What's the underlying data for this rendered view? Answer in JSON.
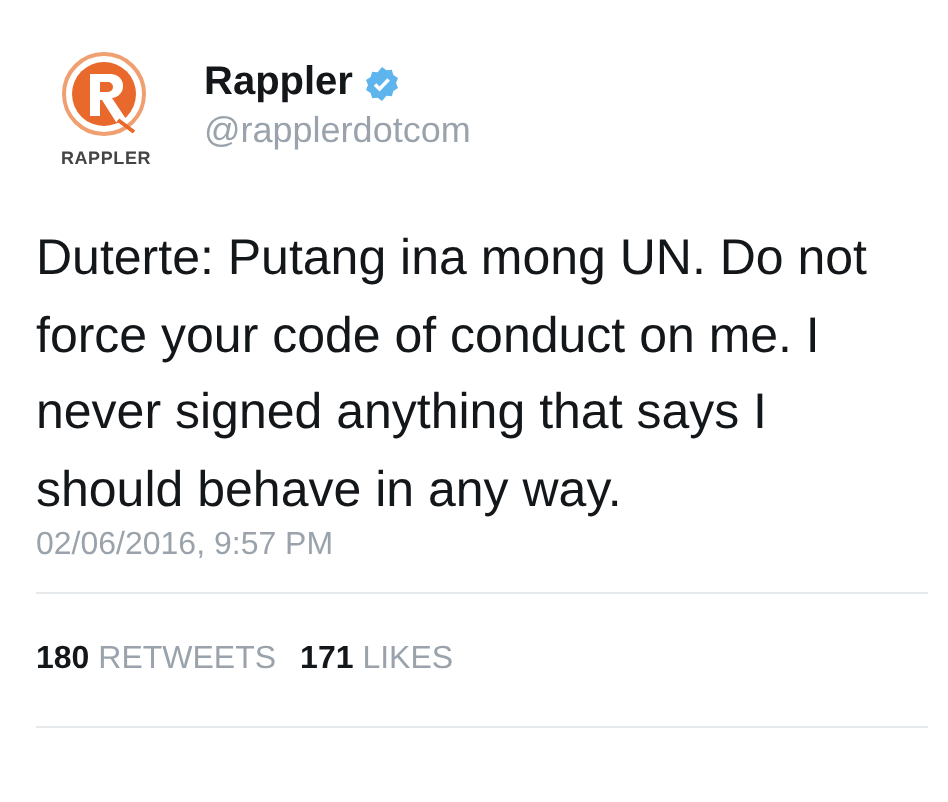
{
  "account": {
    "logo_wordmark": "RAPPLER",
    "name": "Rappler",
    "verified": true,
    "handle": "@rapplerdotcom"
  },
  "tweet": {
    "text": "Duterte: Putang ina mong UN. Do not force your code of conduct on me. I never signed anything that says I should behave in any way.",
    "timestamp": "02/06/2016, 9:57 PM"
  },
  "stats": [
    {
      "count": "180",
      "label": "RETWEETS"
    },
    {
      "count": "171",
      "label": "LIKES"
    }
  ]
}
